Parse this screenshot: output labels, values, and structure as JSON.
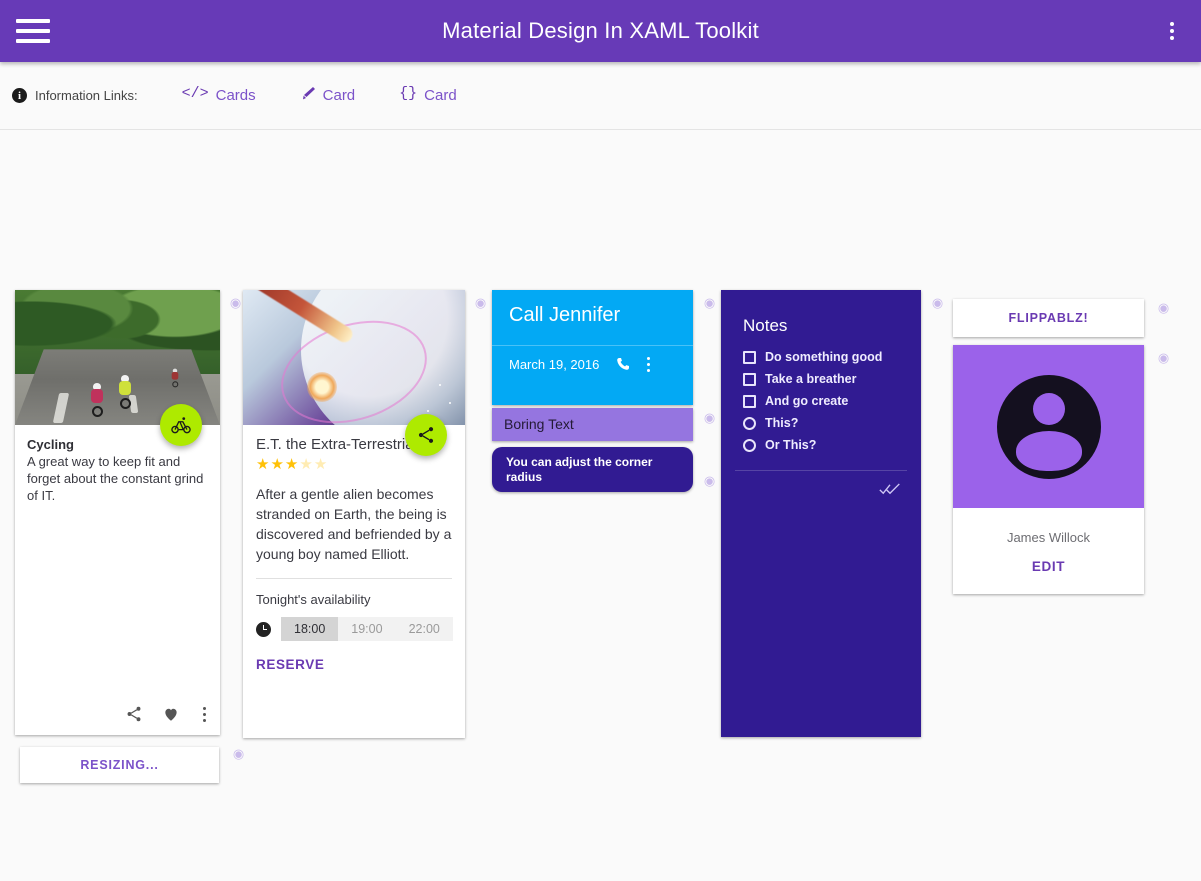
{
  "appbar": {
    "title": "Material Design In XAML Toolkit",
    "menu_icon": "hamburger-icon",
    "overflow_icon": "kebab-menu-icon",
    "background": "#673AB7"
  },
  "linkbar": {
    "info_badge": "i",
    "label": "Information Links:",
    "links": [
      {
        "glyph": "</>",
        "text": "Cards",
        "icon": "code-icon"
      },
      {
        "glyph": "",
        "text": "Card",
        "icon": "brush-icon"
      },
      {
        "glyph": "{}",
        "text": "Card",
        "icon": "braces-icon"
      }
    ]
  },
  "cards": {
    "cycling": {
      "title": "Cycling",
      "description": "A great way to keep fit and forget about the constant grind of IT.",
      "fab_icon": "bicycle-icon",
      "fab_color": "#AEEA00",
      "actions": [
        "share-icon",
        "heart-icon",
        "kebab-menu-icon"
      ]
    },
    "et": {
      "title": "E.T. the Extra-Terrestrial",
      "rating": 3,
      "rating_max": 5,
      "description": "After a gentle alien becomes stranded on Earth, the being is discovered and befriended by a young boy named Elliott.",
      "availability_label": "Tonight's availability",
      "time_slots": [
        "18:00",
        "19:00",
        "22:00"
      ],
      "selected_slot": "18:00",
      "reserve_label": "RESERVE",
      "fab_icon": "share-icon",
      "fab_color": "#AEEA00"
    },
    "call": {
      "title": "Call Jennifer",
      "date": "March 19, 2016",
      "background": "#03A9F4",
      "phone_icon": "phone-icon",
      "overflow_icon": "kebab-menu-icon"
    },
    "boring": {
      "text": "Boring Text",
      "background": "#9575E0"
    },
    "radius": {
      "text": "You can adjust the corner radius",
      "background": "#311B92"
    },
    "notes": {
      "title": "Notes",
      "background": "#311B92",
      "items": [
        {
          "label": "Do something good",
          "type": "checkbox",
          "checked": false
        },
        {
          "label": "Take a breather",
          "type": "checkbox",
          "checked": false
        },
        {
          "label": "And go create",
          "type": "checkbox",
          "checked": false
        },
        {
          "label": "This?",
          "type": "radio",
          "checked": false
        },
        {
          "label": "Or This?",
          "type": "radio",
          "checked": false
        }
      ],
      "footer_icon": "double-check-icon"
    },
    "flippablz": {
      "label": "FLIPPABLZ!"
    },
    "profile": {
      "name": "James Willock",
      "edit_label": "EDIT",
      "avatar_icon": "account-circle-icon",
      "avatar_background": "#9B62EA"
    },
    "resizing": {
      "label": "RESIZING..."
    }
  },
  "adorner": {
    "glyph": "◉"
  }
}
